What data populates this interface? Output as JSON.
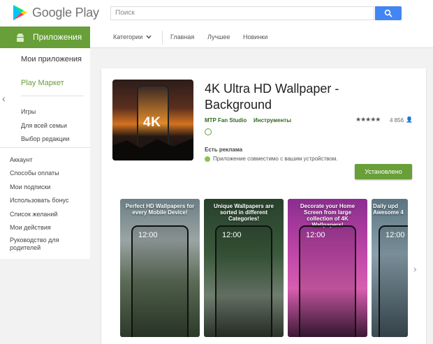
{
  "header": {
    "logo_text": "Google Play",
    "search_placeholder": "Поиск",
    "brand_colors": {
      "green": "#689f38",
      "blue": "#4285f4"
    }
  },
  "nav": {
    "apps_label": "Приложения",
    "items": [
      "Категории",
      "Главная",
      "Лучшее",
      "Новинки"
    ]
  },
  "sidebar": {
    "my_apps": "Мои приложения",
    "play_market": "Play Маркет",
    "sub_items": [
      "Игры",
      "Для всей семьи",
      "Выбор редакции"
    ],
    "account_items": [
      "Аккаунт",
      "Способы оплаты",
      "Мои подписки",
      "Использовать бонус",
      "Список желаний",
      "Мои действия",
      "Руководство для родителей"
    ]
  },
  "app": {
    "title": "4K Ultra HD Wallpaper - Background",
    "icon_text": "4K",
    "developer": "MTP Fan Studio",
    "category": "Инструменты",
    "rating_stars": "★★★★★",
    "rating_count": "4 856",
    "ads_label": "Есть реклама",
    "compat_text": "Приложение совместимо с вашим устройством.",
    "install_label": "Установлено"
  },
  "screenshots": [
    {
      "caption": "Perfect HD Wallpapers for every Mobile Device!",
      "clock": "12:00"
    },
    {
      "caption": "Unique Wallpapers are sorted in different Categories!",
      "clock": "12:00"
    },
    {
      "caption": "Decorate your Home Screen from large collection of 4K Wallpapers!",
      "clock": "12:00"
    },
    {
      "caption": "Daily upd Awesome 4",
      "clock": "12:00"
    }
  ]
}
